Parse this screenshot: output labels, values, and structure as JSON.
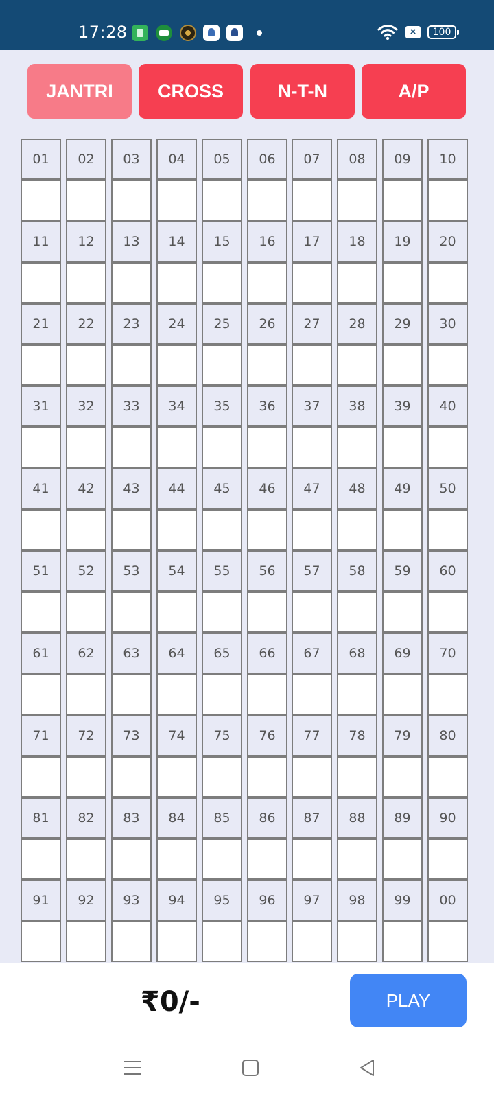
{
  "status_bar": {
    "time": "17:28",
    "sim_glyph": "×",
    "battery": "100",
    "icons": [
      "app-notification-icon",
      "poker-chip-icon",
      "coin-icon",
      "app-notification-icon",
      "app-notification-icon",
      "wifi-icon",
      "sim-icon",
      "battery-icon"
    ]
  },
  "tabs": [
    {
      "label": "JANTRI",
      "active": true
    },
    {
      "label": "CROSS",
      "active": false
    },
    {
      "label": "N-T-N",
      "active": false
    },
    {
      "label": "A/P",
      "active": false
    }
  ],
  "grid": {
    "columns": 10,
    "numbers": [
      "01",
      "02",
      "03",
      "04",
      "05",
      "06",
      "07",
      "08",
      "09",
      "10",
      "11",
      "12",
      "13",
      "14",
      "15",
      "16",
      "17",
      "18",
      "19",
      "20",
      "21",
      "22",
      "23",
      "24",
      "25",
      "26",
      "27",
      "28",
      "29",
      "30",
      "31",
      "32",
      "33",
      "34",
      "35",
      "36",
      "37",
      "38",
      "39",
      "40",
      "41",
      "42",
      "43",
      "44",
      "45",
      "46",
      "47",
      "48",
      "49",
      "50",
      "51",
      "52",
      "53",
      "54",
      "55",
      "56",
      "57",
      "58",
      "59",
      "60",
      "61",
      "62",
      "63",
      "64",
      "65",
      "66",
      "67",
      "68",
      "69",
      "70",
      "71",
      "72",
      "73",
      "74",
      "75",
      "76",
      "77",
      "78",
      "79",
      "80",
      "81",
      "82",
      "83",
      "84",
      "85",
      "86",
      "87",
      "88",
      "89",
      "90",
      "91",
      "92",
      "93",
      "94",
      "95",
      "96",
      "97",
      "98",
      "99",
      "00"
    ]
  },
  "footer": {
    "total": "₹0/-",
    "play_label": "PLAY"
  },
  "nav_bar": {
    "icons": [
      "menu-icon",
      "home-icon",
      "back-icon"
    ]
  },
  "colors": {
    "status_bar": "#144a75",
    "background": "#e8eaf6",
    "tab": "#f63f51",
    "tab_active": "#f77b88",
    "play_button": "#4286f5"
  }
}
